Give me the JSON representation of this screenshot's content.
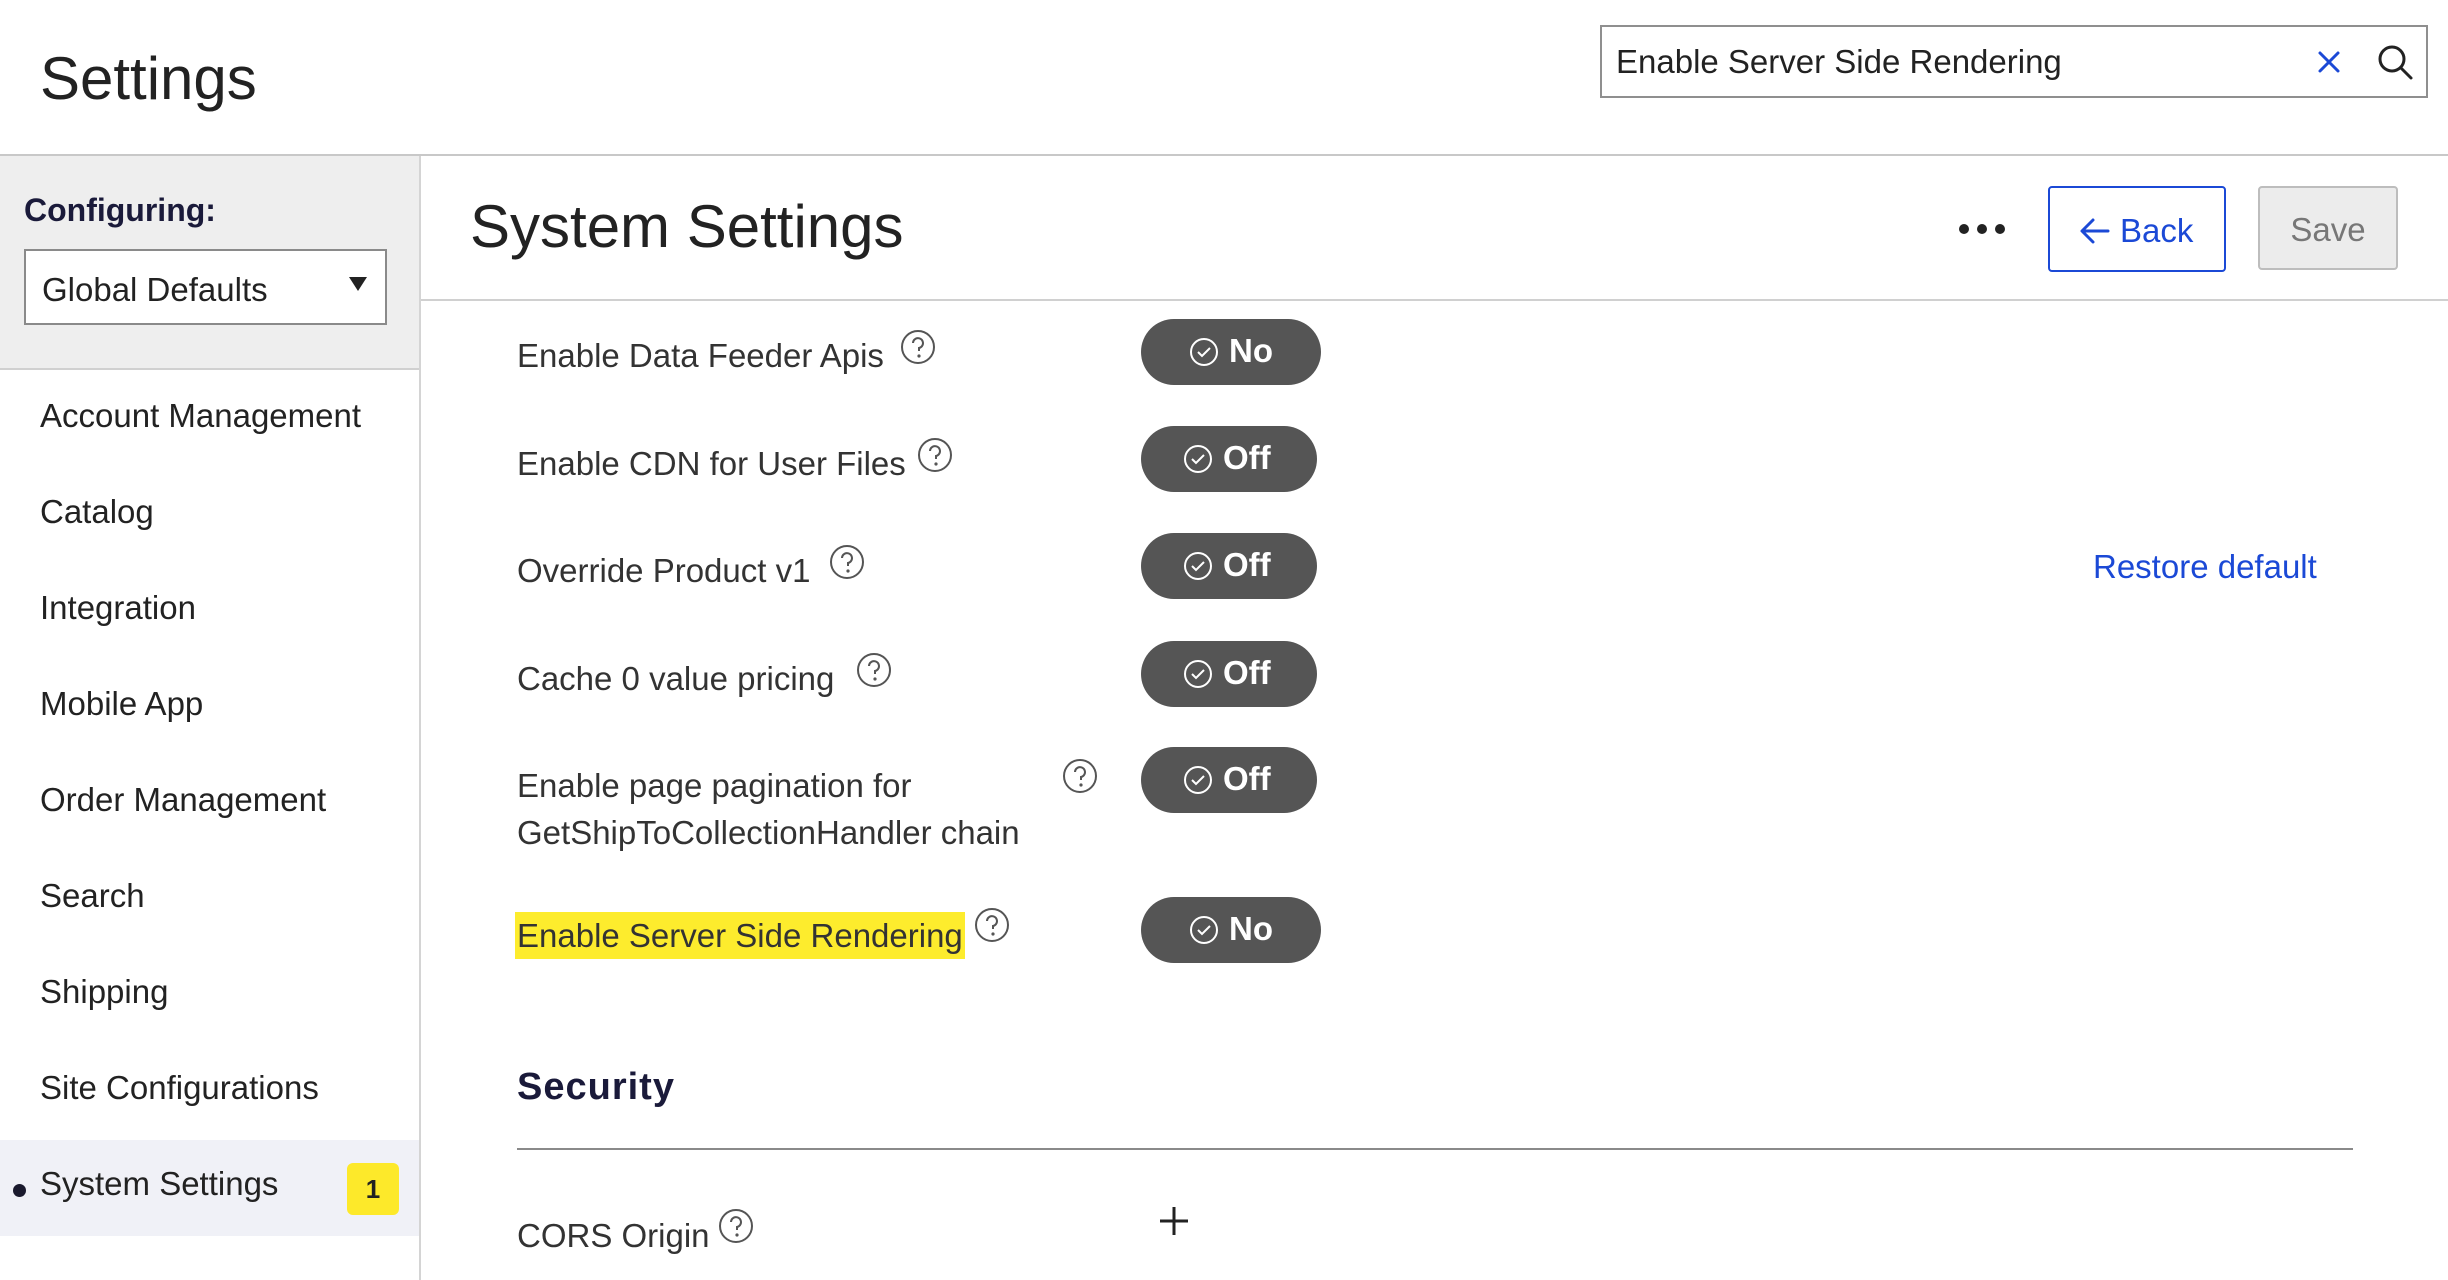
{
  "header": {
    "title": "Settings",
    "search": {
      "value": "Enable Server Side Rendering",
      "clear_icon": "close-icon",
      "search_icon": "search-icon"
    }
  },
  "sidebar": {
    "configuring_label": "Configuring:",
    "configuring_value": "Global Defaults",
    "items": [
      {
        "label": "Account Management"
      },
      {
        "label": "Catalog"
      },
      {
        "label": "Integration"
      },
      {
        "label": "Mobile App"
      },
      {
        "label": "Order Management"
      },
      {
        "label": "Search"
      },
      {
        "label": "Shipping"
      },
      {
        "label": "Site Configurations"
      },
      {
        "label": "System Settings",
        "active": true,
        "badge": "1"
      }
    ]
  },
  "main": {
    "title": "System Settings",
    "back_label": "Back",
    "save_label": "Save",
    "restore_default_label": "Restore default",
    "settings": [
      {
        "label": "Enable Data Feeder Apis",
        "value": "No"
      },
      {
        "label": "Enable CDN for User Files",
        "value": "Off"
      },
      {
        "label": "Override Product v1",
        "value": "Off"
      },
      {
        "label": "Cache 0 value pricing",
        "value": "Off"
      },
      {
        "label_line1": "Enable page pagination for",
        "label_line2": "GetShipToCollectionHandler chain",
        "value": "Off"
      },
      {
        "label": "Enable Server Side Rendering",
        "value": "No",
        "highlighted": true
      }
    ],
    "security": {
      "title": "Security",
      "cors_label": "CORS Origin"
    }
  },
  "colors": {
    "accent": "#1b49d6",
    "highlight": "#fdec2d",
    "toggle_bg": "#555555",
    "badge": "#fde92a"
  }
}
